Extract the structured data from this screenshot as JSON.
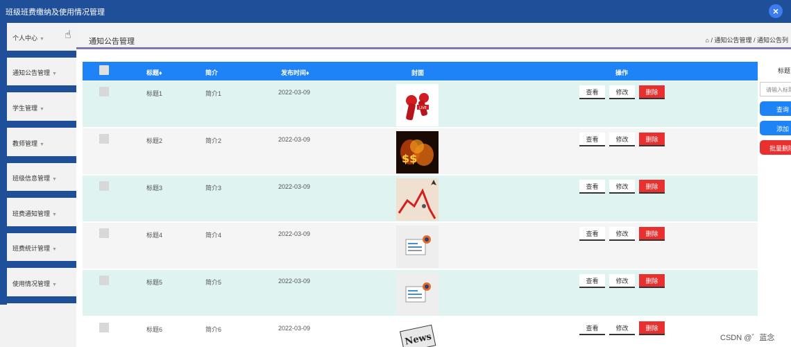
{
  "app": {
    "title": "班级班费缴纳及使用情况管理",
    "close_icon": "×"
  },
  "sidebar": {
    "items": [
      {
        "label": "个人中心"
      },
      {
        "label": "通知公告管理"
      },
      {
        "label": "学生管理"
      },
      {
        "label": "教师管理"
      },
      {
        "label": "班级信息管理"
      },
      {
        "label": "班费通知管理"
      },
      {
        "label": "班费统计管理"
      },
      {
        "label": "使用情况管理"
      }
    ],
    "arrow": "▼"
  },
  "header": {
    "title": "通知公告管理",
    "breadcrumb": "⌂ / 通知公告管理 / 通知公告列"
  },
  "table": {
    "columns": [
      "标题♦",
      "简介",
      "发布时间♦",
      "封面",
      "操作"
    ],
    "rows": [
      {
        "title": "标题1",
        "intro": "简介1",
        "date": "2022-03-09",
        "cover": "microphone-image"
      },
      {
        "title": "标题2",
        "intro": "简介2",
        "date": "2022-03-09",
        "cover": "money-fire-image"
      },
      {
        "title": "标题3",
        "intro": "简介3",
        "date": "2022-03-09",
        "cover": "falling-chart-image"
      },
      {
        "title": "标题4",
        "intro": "简介4",
        "date": "2022-03-09",
        "cover": "news-icon-image"
      },
      {
        "title": "标题5",
        "intro": "简介5",
        "date": "2022-03-09",
        "cover": "news-icon-image"
      },
      {
        "title": "标题6",
        "intro": "简介6",
        "date": "2022-03-09",
        "cover": "newspaper-image"
      }
    ],
    "actions": {
      "view": "查看",
      "edit": "修改",
      "delete": "删除"
    }
  },
  "search": {
    "label": "标题",
    "placeholder": "请输入标题",
    "query_button": "查询",
    "add_button": "添加",
    "batch_delete_button": "批量删除"
  },
  "colors": {
    "topbar": "#1e4f98",
    "table_header": "#1e83f7",
    "delete": "#e8302e",
    "row_tint": "#dff3f1"
  },
  "watermark": "CSDN @゛蓝念"
}
